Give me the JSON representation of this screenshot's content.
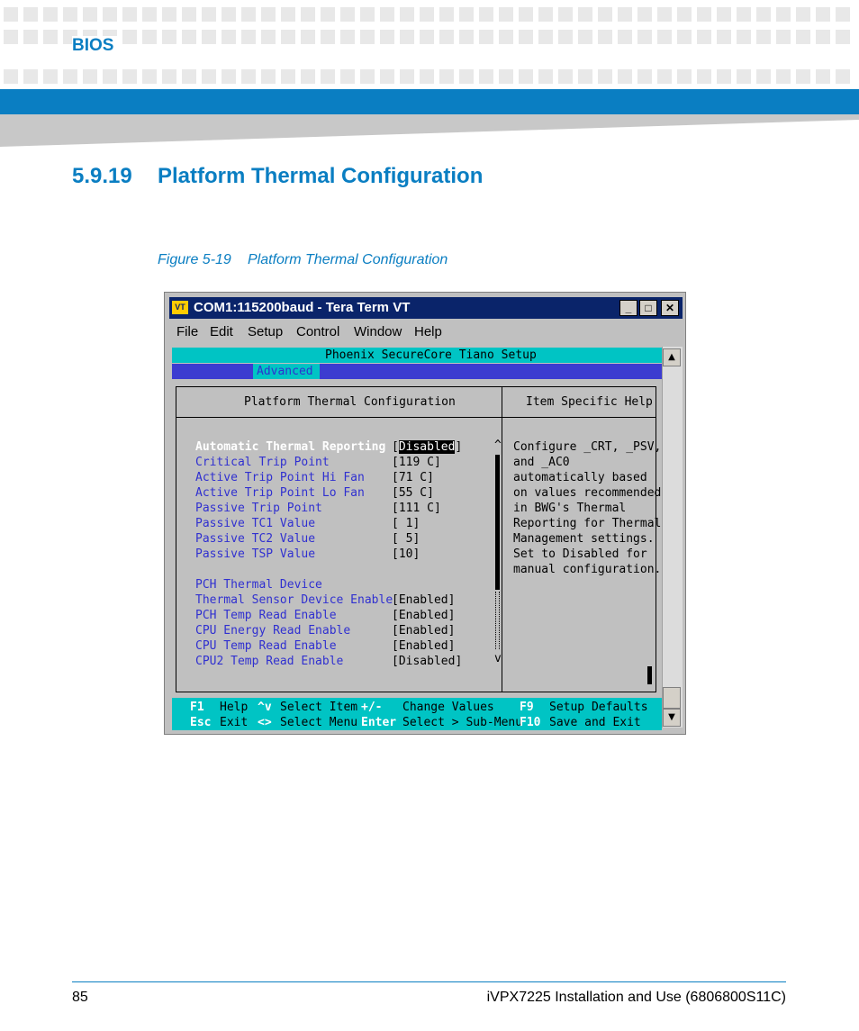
{
  "header": {
    "label": "BIOS"
  },
  "section": {
    "number": "5.9.19",
    "title": "Platform Thermal Configuration"
  },
  "figure": {
    "number": "Figure 5-19",
    "title": "Platform Thermal Configuration"
  },
  "window": {
    "title": "COM1:115200baud - Tera Term VT",
    "menu": [
      "File",
      "Edit",
      "Setup",
      "Control",
      "Window",
      "Help"
    ]
  },
  "bios": {
    "setup_title": "Phoenix SecureCore Tiano Setup",
    "tab": "Advanced",
    "panel_title": "Platform Thermal Configuration",
    "help_title": "Item Specific Help",
    "items": [
      {
        "label": "Automatic Thermal Reporting",
        "value": "Disabled"
      },
      {
        "label": "Critical Trip Point",
        "value": "[119 C]"
      },
      {
        "label": "Active Trip Point Hi Fan",
        "value": "[71 C]"
      },
      {
        "label": "Active Trip Point Lo Fan",
        "value": "[55 C]"
      },
      {
        "label": "Passive Trip Point",
        "value": "[111 C]"
      },
      {
        "label": "Passive TC1 Value",
        "value": "[ 1]"
      },
      {
        "label": "Passive TC2 Value",
        "value": "[ 5]"
      },
      {
        "label": "Passive TSP Value",
        "value": "[10]"
      },
      {
        "label": "PCH Thermal Device",
        "value": ""
      },
      {
        "label": "Thermal Sensor Device Enable",
        "value": "[Enabled]"
      },
      {
        "label": "PCH Temp Read Enable",
        "value": "[Enabled]"
      },
      {
        "label": "CPU Energy Read Enable",
        "value": "[Enabled]"
      },
      {
        "label": "CPU Temp Read Enable",
        "value": "[Enabled]"
      },
      {
        "label": "CPU2 Temp Read Enable",
        "value": "[Disabled]"
      }
    ],
    "help_lines": [
      "Configure _CRT, _PSV,",
      "and _AC0",
      "automatically based",
      "on values recommended",
      "in BWG's Thermal",
      "Reporting for Thermal",
      "Management settings.",
      "Set to Disabled for",
      "manual configuration."
    ],
    "scroll_up": "^",
    "scroll_down": "v",
    "keys_row1": [
      {
        "key": "F1",
        "desc": "Help"
      },
      {
        "key": "^v",
        "desc": "Select Item"
      },
      {
        "key": "+/-",
        "desc": "Change Values"
      },
      {
        "key": "F9",
        "desc": "Setup Defaults"
      }
    ],
    "keys_row2": [
      {
        "key": "Esc",
        "desc": "Exit"
      },
      {
        "key": "<>",
        "desc": "Select Menu"
      },
      {
        "key": "Enter",
        "desc": "Select > Sub-Menu"
      },
      {
        "key": "F10",
        "desc": "Save and Exit"
      }
    ]
  },
  "footer": {
    "page": "85",
    "doc": "iVPX7225 Installation and Use (6806800S11C)"
  }
}
